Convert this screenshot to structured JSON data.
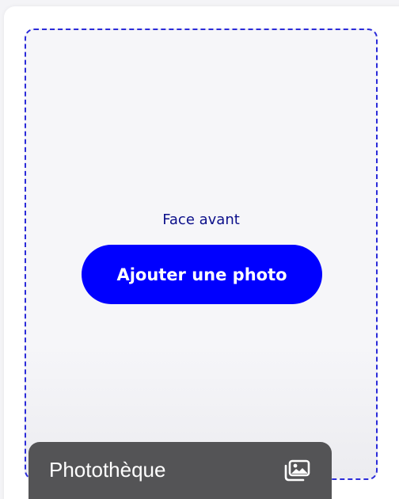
{
  "upload": {
    "face_label": "Face avant",
    "button_label": "Ajouter une photo"
  },
  "context_menu": {
    "items": [
      {
        "label": "Photothèque",
        "icon": "photo-library-icon"
      }
    ]
  },
  "colors": {
    "accent": "#0000ff",
    "label_text": "#0b0f8a",
    "dashed_border": "#2b2bd9",
    "menu_background": "#545456"
  }
}
